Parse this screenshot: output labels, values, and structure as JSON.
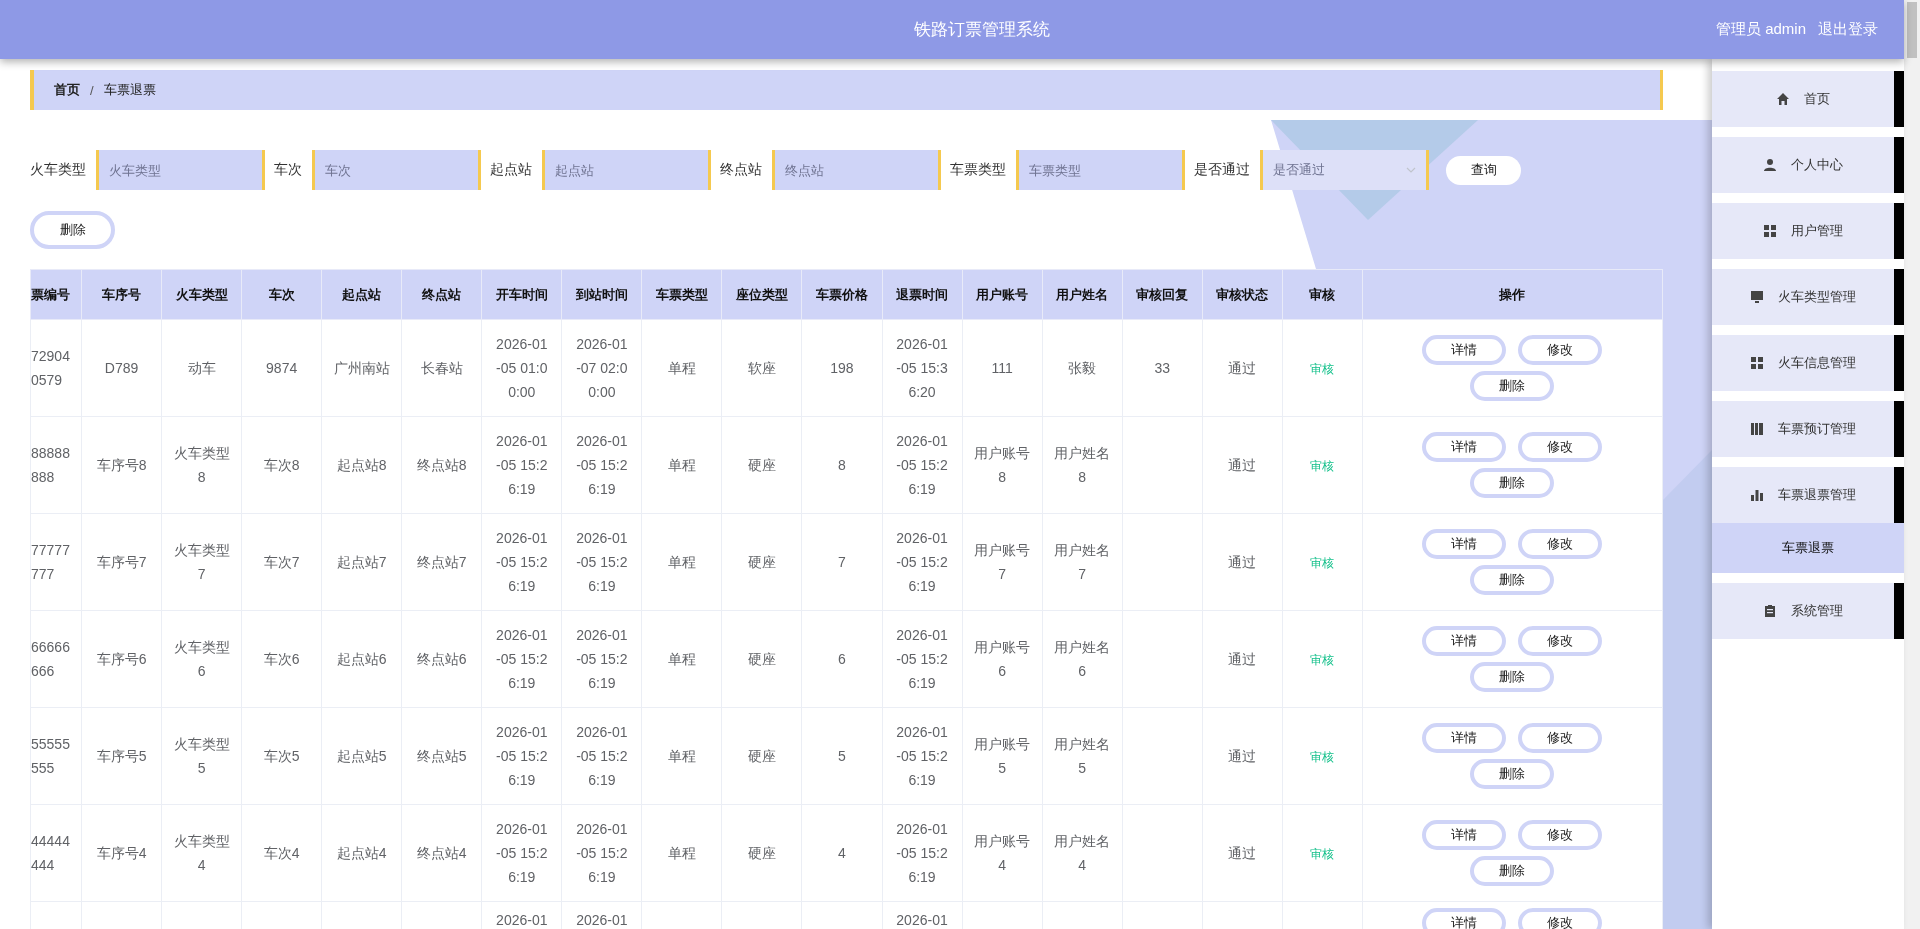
{
  "header": {
    "title": "铁路订票管理系统",
    "user": "管理员 admin",
    "logout": "退出登录"
  },
  "breadcrumb": {
    "items": [
      "首页",
      "车票退票"
    ],
    "separator": "/"
  },
  "filters": [
    {
      "label": "火车类型",
      "placeholder": "火车类型",
      "kind": "input"
    },
    {
      "label": "车次",
      "placeholder": "车次",
      "kind": "input"
    },
    {
      "label": "起点站",
      "placeholder": "起点站",
      "kind": "input"
    },
    {
      "label": "终点站",
      "placeholder": "终点站",
      "kind": "input"
    },
    {
      "label": "车票类型",
      "placeholder": "车票类型",
      "kind": "input"
    },
    {
      "label": "是否通过",
      "placeholder": "是否通过",
      "kind": "select"
    }
  ],
  "search_button": "查询",
  "delete_button": "删除",
  "table": {
    "columns": [
      {
        "label": "票编号",
        "kind": "id"
      },
      {
        "label": "车序号",
        "kind": "text"
      },
      {
        "label": "火车类型",
        "kind": "text"
      },
      {
        "label": "车次",
        "kind": "text"
      },
      {
        "label": "起点站",
        "kind": "text"
      },
      {
        "label": "终点站",
        "kind": "text"
      },
      {
        "label": "开车时间",
        "kind": "time"
      },
      {
        "label": "到站时间",
        "kind": "time"
      },
      {
        "label": "车票类型",
        "kind": "text"
      },
      {
        "label": "座位类型",
        "kind": "text"
      },
      {
        "label": "车票价格",
        "kind": "text"
      },
      {
        "label": "退票时间",
        "kind": "time"
      },
      {
        "label": "用户账号",
        "kind": "text"
      },
      {
        "label": "用户姓名",
        "kind": "text"
      },
      {
        "label": "审核回复",
        "kind": "text"
      },
      {
        "label": "审核状态",
        "kind": "text"
      },
      {
        "label": "审核",
        "kind": "link"
      },
      {
        "label": "操作",
        "kind": "actions"
      }
    ],
    "rows": [
      {
        "kind": "full",
        "cells": [
          "72904 0579",
          "D789",
          "动车",
          "9874",
          "广州南站",
          "长春站",
          "2026-01-05 01:00:00",
          "2026-01-07 02:00:00",
          "单程",
          "软座",
          "198",
          "2026-01-05 15:36:20",
          "111",
          "张毅",
          "33",
          "通过"
        ],
        "review": "审核",
        "actions": [
          "详情",
          "修改",
          "删除"
        ]
      },
      {
        "kind": "full",
        "cells": [
          "88888 888",
          "车序号8",
          "火车类型8",
          "车次8",
          "起点站8",
          "终点站8",
          "2026-01-05 15:26:19",
          "2026-01-05 15:26:19",
          "单程",
          "硬座",
          "8",
          "2026-01-05 15:26:19",
          "用户账号8",
          "用户姓名8",
          null,
          "通过"
        ],
        "review": "审核",
        "actions": [
          "详情",
          "修改",
          "删除"
        ]
      },
      {
        "kind": "full",
        "cells": [
          "77777 777",
          "车序号7",
          "火车类型7",
          "车次7",
          "起点站7",
          "终点站7",
          "2026-01-05 15:26:19",
          "2026-01-05 15:26:19",
          "单程",
          "硬座",
          "7",
          "2026-01-05 15:26:19",
          "用户账号7",
          "用户姓名7",
          null,
          "通过"
        ],
        "review": "审核",
        "actions": [
          "详情",
          "修改",
          "删除"
        ]
      },
      {
        "kind": "full",
        "cells": [
          "66666 666",
          "车序号6",
          "火车类型6",
          "车次6",
          "起点站6",
          "终点站6",
          "2026-01-05 15:26:19",
          "2026-01-05 15:26:19",
          "单程",
          "硬座",
          "6",
          "2026-01-05 15:26:19",
          "用户账号6",
          "用户姓名6",
          null,
          "通过"
        ],
        "review": "审核",
        "actions": [
          "详情",
          "修改",
          "删除"
        ]
      },
      {
        "kind": "full",
        "cells": [
          "55555 555",
          "车序号5",
          "火车类型5",
          "车次5",
          "起点站5",
          "终点站5",
          "2026-01-05 15:26:19",
          "2026-01-05 15:26:19",
          "单程",
          "硬座",
          "5",
          "2026-01-05 15:26:19",
          "用户账号5",
          "用户姓名5",
          null,
          "通过"
        ],
        "review": "审核",
        "actions": [
          "详情",
          "修改",
          "删除"
        ]
      },
      {
        "kind": "full",
        "cells": [
          "44444 444",
          "车序号4",
          "火车类型4",
          "车次4",
          "起点站4",
          "终点站4",
          "2026-01-05 15:26:19",
          "2026-01-05 15:26:19",
          "单程",
          "硬座",
          "4",
          "2026-01-05 15:26:19",
          "用户账号4",
          "用户姓名4",
          null,
          "通过"
        ],
        "review": "审核",
        "actions": [
          "详情",
          "修改",
          "删除"
        ]
      },
      {
        "kind": "cut",
        "cells": [
          null,
          null,
          null,
          null,
          null,
          null,
          "2026-01",
          "2026-01",
          null,
          null,
          null,
          "2026-01",
          null,
          null,
          null,
          null
        ],
        "actions": [
          "详情",
          "修改"
        ]
      }
    ]
  },
  "sidebar": {
    "items": [
      {
        "label": "首页",
        "selected": false
      },
      {
        "label": "个人中心",
        "selected": false
      },
      {
        "label": "用户管理",
        "selected": false
      },
      {
        "label": "火车类型管理",
        "selected": false
      },
      {
        "label": "火车信息管理",
        "selected": false
      },
      {
        "label": "车票预订管理",
        "selected": false
      },
      {
        "label": "车票退票管理",
        "selected": false,
        "expanded": true,
        "children": [
          {
            "label": "车票退票",
            "selected": true
          }
        ]
      },
      {
        "label": "系统管理",
        "selected": false
      }
    ]
  }
}
